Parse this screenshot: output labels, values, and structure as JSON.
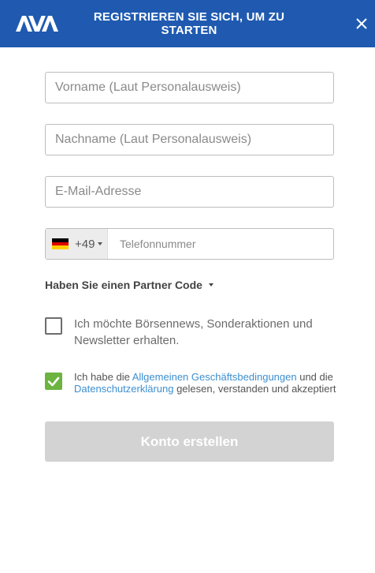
{
  "header": {
    "logo_text": "AVA",
    "title": "REGISTRIEREN SIE SICH, UM ZU STARTEN",
    "close_icon": "close-icon",
    "bg_color": "#1f5ab0"
  },
  "form": {
    "first_name": {
      "placeholder": "Vorname (Laut Personalausweis)",
      "value": ""
    },
    "last_name": {
      "placeholder": "Nachname (Laut Personalausweis)",
      "value": ""
    },
    "email": {
      "placeholder": "E-Mail-Adresse",
      "value": ""
    },
    "phone": {
      "country_flag": "germany-flag-icon",
      "dial_code": "+49",
      "placeholder": "Telefonnummer",
      "value": ""
    },
    "partner_code_label": "Haben Sie einen Partner Code",
    "newsletter": {
      "checked": false,
      "label": "Ich möchte Börsennews, Sonderaktionen und Newsletter erhalten."
    },
    "terms": {
      "checked": true,
      "check_color": "#6cb33f",
      "text_before": "Ich habe die ",
      "link1": "Allgemeinen Geschäftsbedingungen",
      "text_middle": " und die ",
      "link2": "Datenschutzerklärung",
      "text_after": " gelesen, verstanden und akzeptiert",
      "link_color": "#3c8fd0"
    },
    "submit_label": "Konto erstellen",
    "submit_color": "#d3d3d3"
  }
}
